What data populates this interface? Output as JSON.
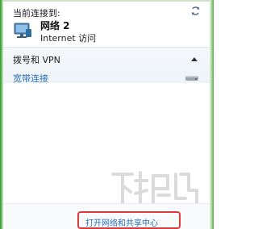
{
  "panel": {
    "current_connection_heading": "当前连接到:",
    "network": {
      "name": "网络 2",
      "status": "Internet 访问",
      "icon": "network-icon"
    },
    "dialup_section": {
      "heading": "拨号和 VPN",
      "items": [
        {
          "label": "宽带连接",
          "icon": "modem-icon"
        }
      ]
    },
    "footer": {
      "link_label": "打开网络和共享中心"
    },
    "watermark": "下载吧",
    "colors": {
      "link": "#2a6fb6",
      "highlight": "#d93a3a",
      "edge": "#4aa04a"
    }
  }
}
